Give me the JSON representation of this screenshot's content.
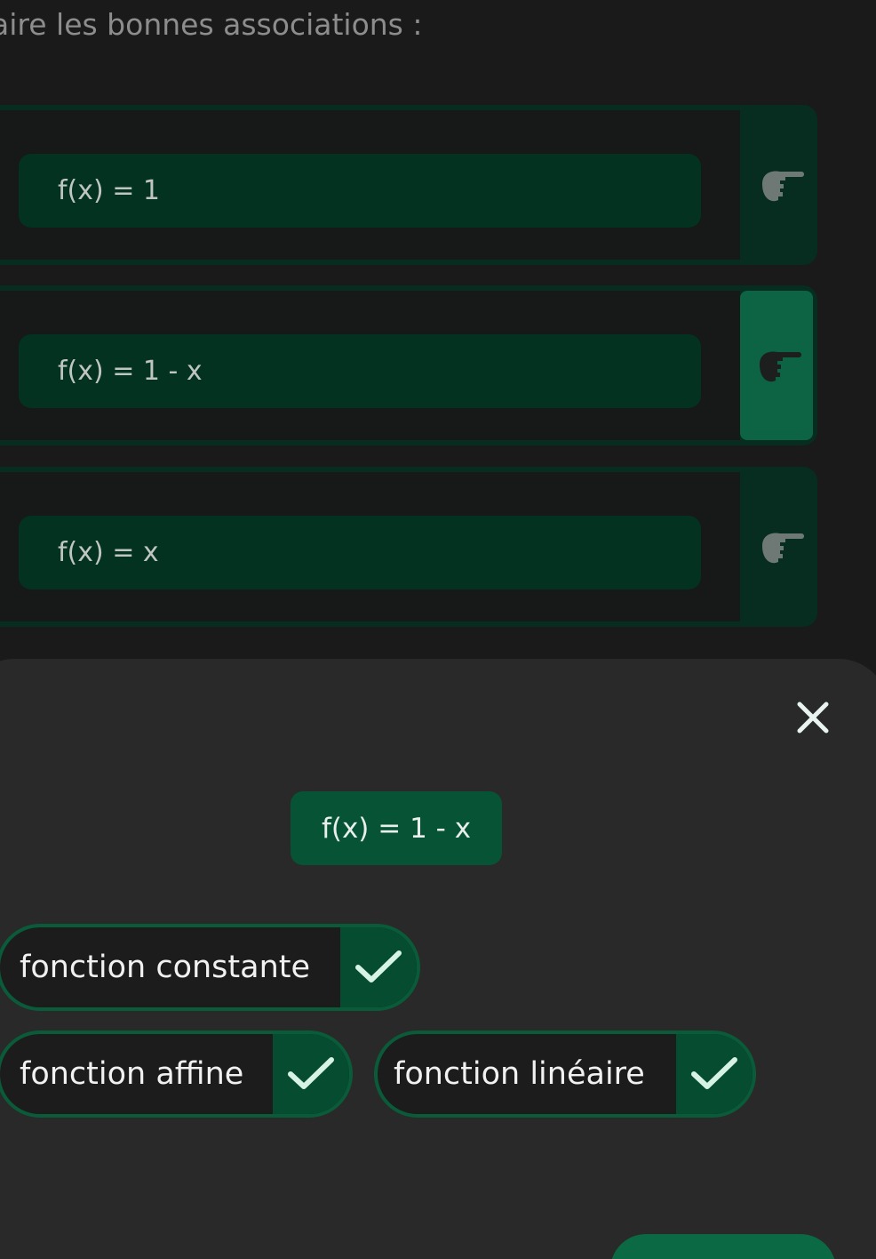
{
  "instruction": "aire les bonnes associations :",
  "rows": [
    {
      "formula": "f(x) = 1",
      "icon": "pointing-hand-icon",
      "active": false
    },
    {
      "formula": "f(x) = 1 - x",
      "icon": "pointing-hand-icon",
      "active": true
    },
    {
      "formula": "f(x) = x",
      "icon": "pointing-hand-icon",
      "active": false
    }
  ],
  "sheet": {
    "close_icon": "close-icon",
    "selected_formula": "f(x) = 1 - x",
    "options": [
      {
        "label": "fonction constante",
        "icon": "check-icon"
      },
      {
        "label": "fonction affine",
        "icon": "check-icon"
      },
      {
        "label": "fonction linéaire",
        "icon": "check-icon"
      }
    ]
  },
  "colors": {
    "background": "#1a1a1b",
    "accent_green": "#0c6444",
    "dark_green": "#033220",
    "sheet": "#292929",
    "check": "#d6f3e6"
  }
}
